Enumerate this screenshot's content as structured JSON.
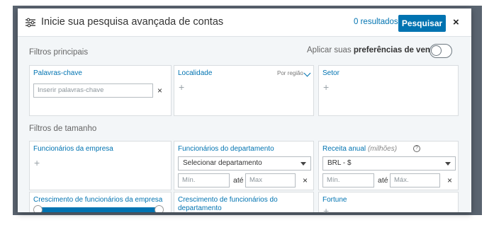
{
  "header": {
    "title": "Inicie sua pesquisa avançada de contas",
    "result_count": "0 resultados",
    "search_label": "Pesquisar",
    "close_label": "×"
  },
  "main_filters": {
    "label": "Filtros principais",
    "prefs_prefix": "Aplicar suas ",
    "prefs_bold": "preferências de vendas",
    "keywords": {
      "title": "Palavras-chave",
      "placeholder": "Inserir palavras-chave",
      "clear": "×"
    },
    "location": {
      "title": "Localidade",
      "region": "Por região",
      "add": "+"
    },
    "sector": {
      "title": "Setor",
      "add": "+"
    }
  },
  "size_filters": {
    "label": "Filtros de tamanho",
    "company_employees": {
      "title": "Funcionários da empresa",
      "add": "+"
    },
    "department_employees": {
      "title": "Funcionários do departamento",
      "select_value": "Selecionar departamento",
      "min_placeholder": "Mín.",
      "to": "até",
      "max_placeholder": "Max",
      "clear": "×"
    },
    "annual_revenue": {
      "title": "Receita anual",
      "unit": "(milhões)",
      "help": "?",
      "currency": "BRL - $",
      "min_placeholder": "Mín.",
      "to": "até",
      "max_placeholder": "Máx.",
      "clear": "×"
    },
    "employee_growth": {
      "title": "Crescimento de funcionários da empresa"
    },
    "department_growth": {
      "title": "Crescimento de funcionários do departamento"
    },
    "fortune": {
      "title": "Fortune",
      "add": "+"
    }
  }
}
